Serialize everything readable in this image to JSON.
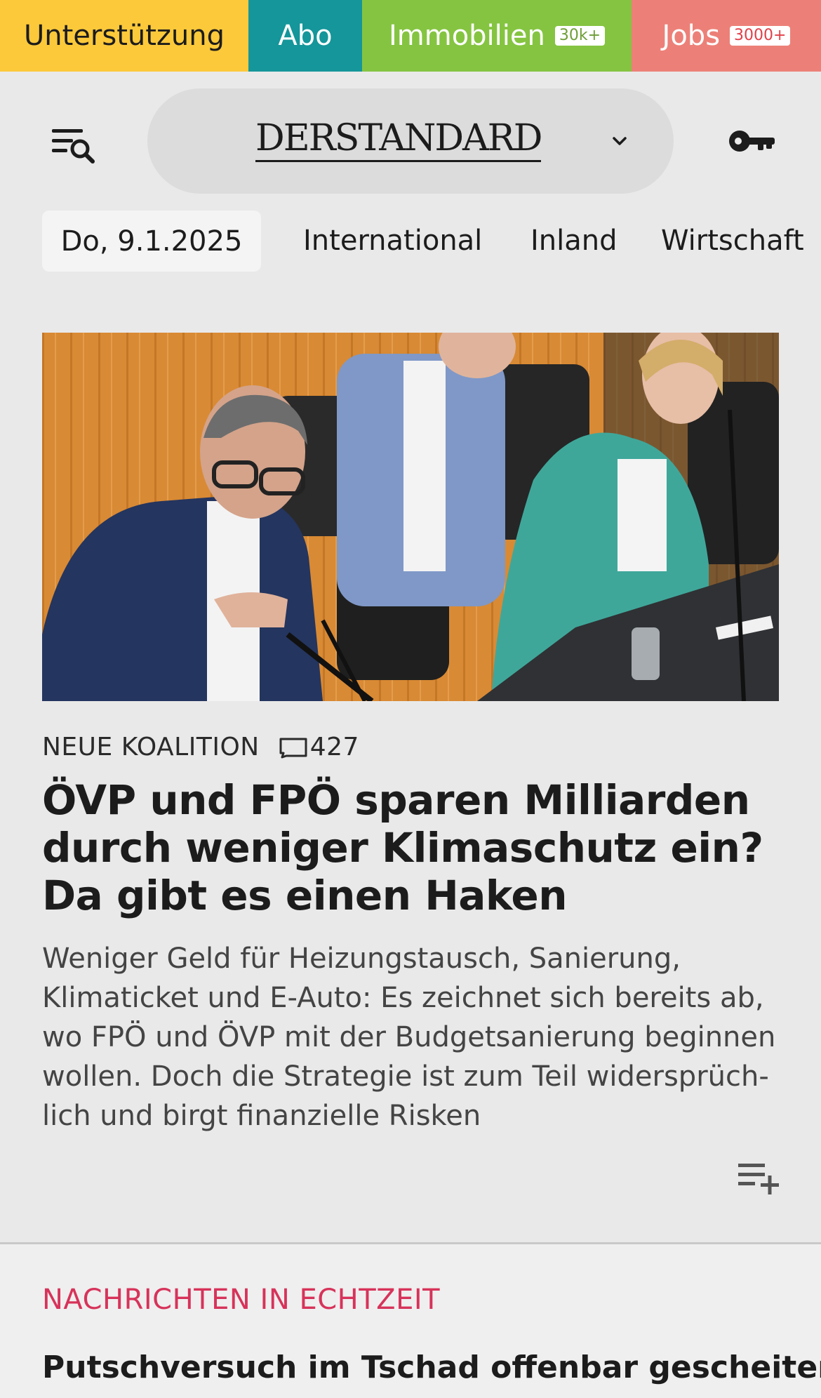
{
  "topbar": {
    "support": "Unterstützung",
    "abo": "Abo",
    "immobilien": "Immobilien",
    "immobilien_badge": "30k+",
    "jobs": "Jobs",
    "jobs_badge": "3000+"
  },
  "header": {
    "logo": "DERSTANDARD",
    "menu_icon": "menu-search-icon",
    "chevron_icon": "chevron-down-icon",
    "login_icon": "key-icon"
  },
  "nav": {
    "date": "Do, 9.1.2025",
    "items": [
      "International",
      "Inland",
      "Wirtschaft"
    ]
  },
  "lead_article": {
    "image_alt": "Politiker auf einer Pressekonferenz",
    "kicker": "NEUE KOALITION",
    "comment_count": "427",
    "headline": "ÖVP und FPÖ sparen Milliarden durch weniger Klimaschutz ein? Da gibt es einen Haken",
    "teaser": "Weniger Geld für Heizungstausch, Sanierung, Klimaticket und E-Auto: Es zeichnet sich bereits ab, wo FPÖ und ÖVP mit der Budgetsanierung beginnen wollen. Doch die Strategie ist zum Teil widersprüch­lich und birgt finanzielle Risken"
  },
  "live": {
    "label": "NACHRICHTEN IN ECHTZEIT",
    "first_headline": "Putschversuch im Tschad offenbar gescheitert"
  },
  "colors": {
    "support": "#fcc93b",
    "abo": "#14969a",
    "immobilien": "#85c441",
    "jobs": "#ec8078",
    "live_accent": "#d7335a"
  }
}
